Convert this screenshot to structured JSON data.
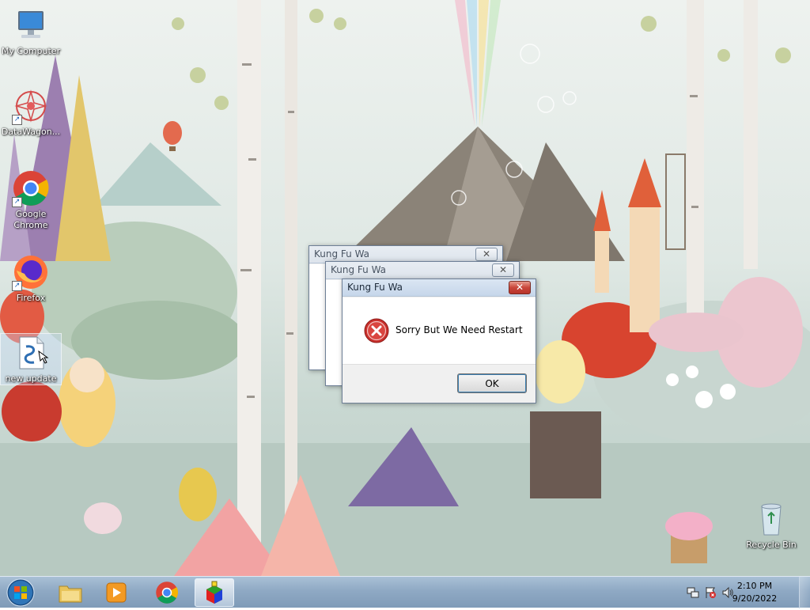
{
  "desktop": {
    "icons": [
      {
        "label": "My Computer",
        "icon": "computer-icon"
      },
      {
        "label": "DataWagon...",
        "icon": "datawagon-icon"
      },
      {
        "label": "Google Chrome",
        "icon": "chrome-icon"
      },
      {
        "label": "Firefox",
        "icon": "firefox-icon"
      },
      {
        "label": "new update",
        "icon": "script-file-icon"
      },
      {
        "label": "Recycle Bin",
        "icon": "recycle-bin-icon"
      }
    ]
  },
  "dialogs": [
    {
      "title": "Kung Fu Wa",
      "state": "inactive"
    },
    {
      "title": "Kung Fu Wa",
      "state": "inactive"
    },
    {
      "title": "Kung Fu Wa",
      "state": "active",
      "message": "Sorry But We Need Restart",
      "button": "OK",
      "icon": "error-icon"
    }
  ],
  "taskbar": {
    "items": [
      {
        "icon": "start-orb-icon"
      },
      {
        "icon": "file-explorer-icon"
      },
      {
        "icon": "media-player-icon"
      },
      {
        "icon": "chrome-icon"
      },
      {
        "icon": "app-cube-icon",
        "active": true
      }
    ],
    "tray": {
      "icons": [
        "network-icon",
        "action-center-icon",
        "volume-icon"
      ]
    },
    "clock": {
      "time": "2:10 PM",
      "date": "9/20/2022"
    }
  },
  "colors": {
    "taskbar": "#8fa9c4",
    "error_red": "#c9302c",
    "title_active": "#c6d6ea"
  }
}
